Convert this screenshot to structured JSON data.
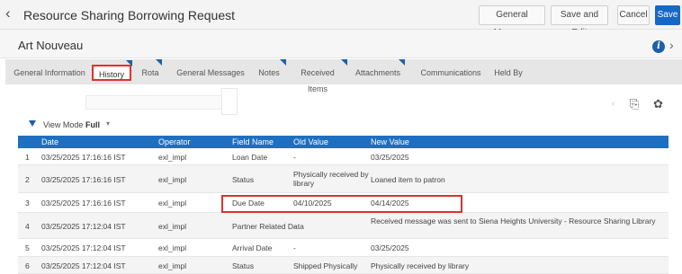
{
  "header": {
    "title": "Resource Sharing Borrowing Request",
    "buttons": {
      "general_message": "General Message",
      "save_and_edit": "Save and Edit",
      "cancel": "Cancel",
      "save": "Save"
    }
  },
  "record": {
    "title": "Art Nouveau"
  },
  "tabs": [
    {
      "label": "General Information"
    },
    {
      "label": "History"
    },
    {
      "label": "Rota"
    },
    {
      "label": "General Messages"
    },
    {
      "label": "Notes"
    },
    {
      "label": "Received Items"
    },
    {
      "label": "Attachments"
    },
    {
      "label": "Communications"
    },
    {
      "label": "Held By"
    }
  ],
  "view_mode": {
    "label": "View Mode :",
    "value": "Full"
  },
  "table": {
    "columns": [
      "Date",
      "Operator",
      "Field Name",
      "Old Value",
      "New Value"
    ],
    "rows": [
      {
        "num": "1",
        "date": "03/25/2025 17:16:16 IST",
        "operator": "exl_impl",
        "field": "Loan Date",
        "old": "-",
        "new": "03/25/2025"
      },
      {
        "num": "2",
        "date": "03/25/2025 17:16:16 IST",
        "operator": "exl_impl",
        "field": "Status",
        "old": "Physically received by library",
        "new": "Loaned item to patron"
      },
      {
        "num": "3",
        "date": "03/25/2025 17:16:16 IST",
        "operator": "exl_impl",
        "field": "Due Date",
        "old": "04/10/2025",
        "new": "04/14/2025"
      },
      {
        "num": "4",
        "date": "03/25/2025 17:12:04 IST",
        "operator": "exl_impl",
        "field": "Partner Related Data",
        "old": "-",
        "new": "Received message was sent to Siena Heights University - Resource Sharing Library"
      },
      {
        "num": "5",
        "date": "03/25/2025 17:12:04 IST",
        "operator": "exl_impl",
        "field": "Arrival Date",
        "old": "-",
        "new": "03/25/2025"
      },
      {
        "num": "6",
        "date": "03/25/2025 17:12:04 IST",
        "operator": "exl_impl",
        "field": "Status",
        "old": "Shipped Physically",
        "new": "Physically received by library"
      }
    ]
  },
  "icons": {
    "back": "chevron-left-icon",
    "info": "info-icon",
    "next": "chevron-right-icon",
    "filter": "funnel-icon",
    "export": "export-icon",
    "settings": "gear-icon"
  },
  "colors": {
    "accent": "#1f6fc0",
    "primary_button": "#1768c4",
    "highlight": "#e03030"
  }
}
